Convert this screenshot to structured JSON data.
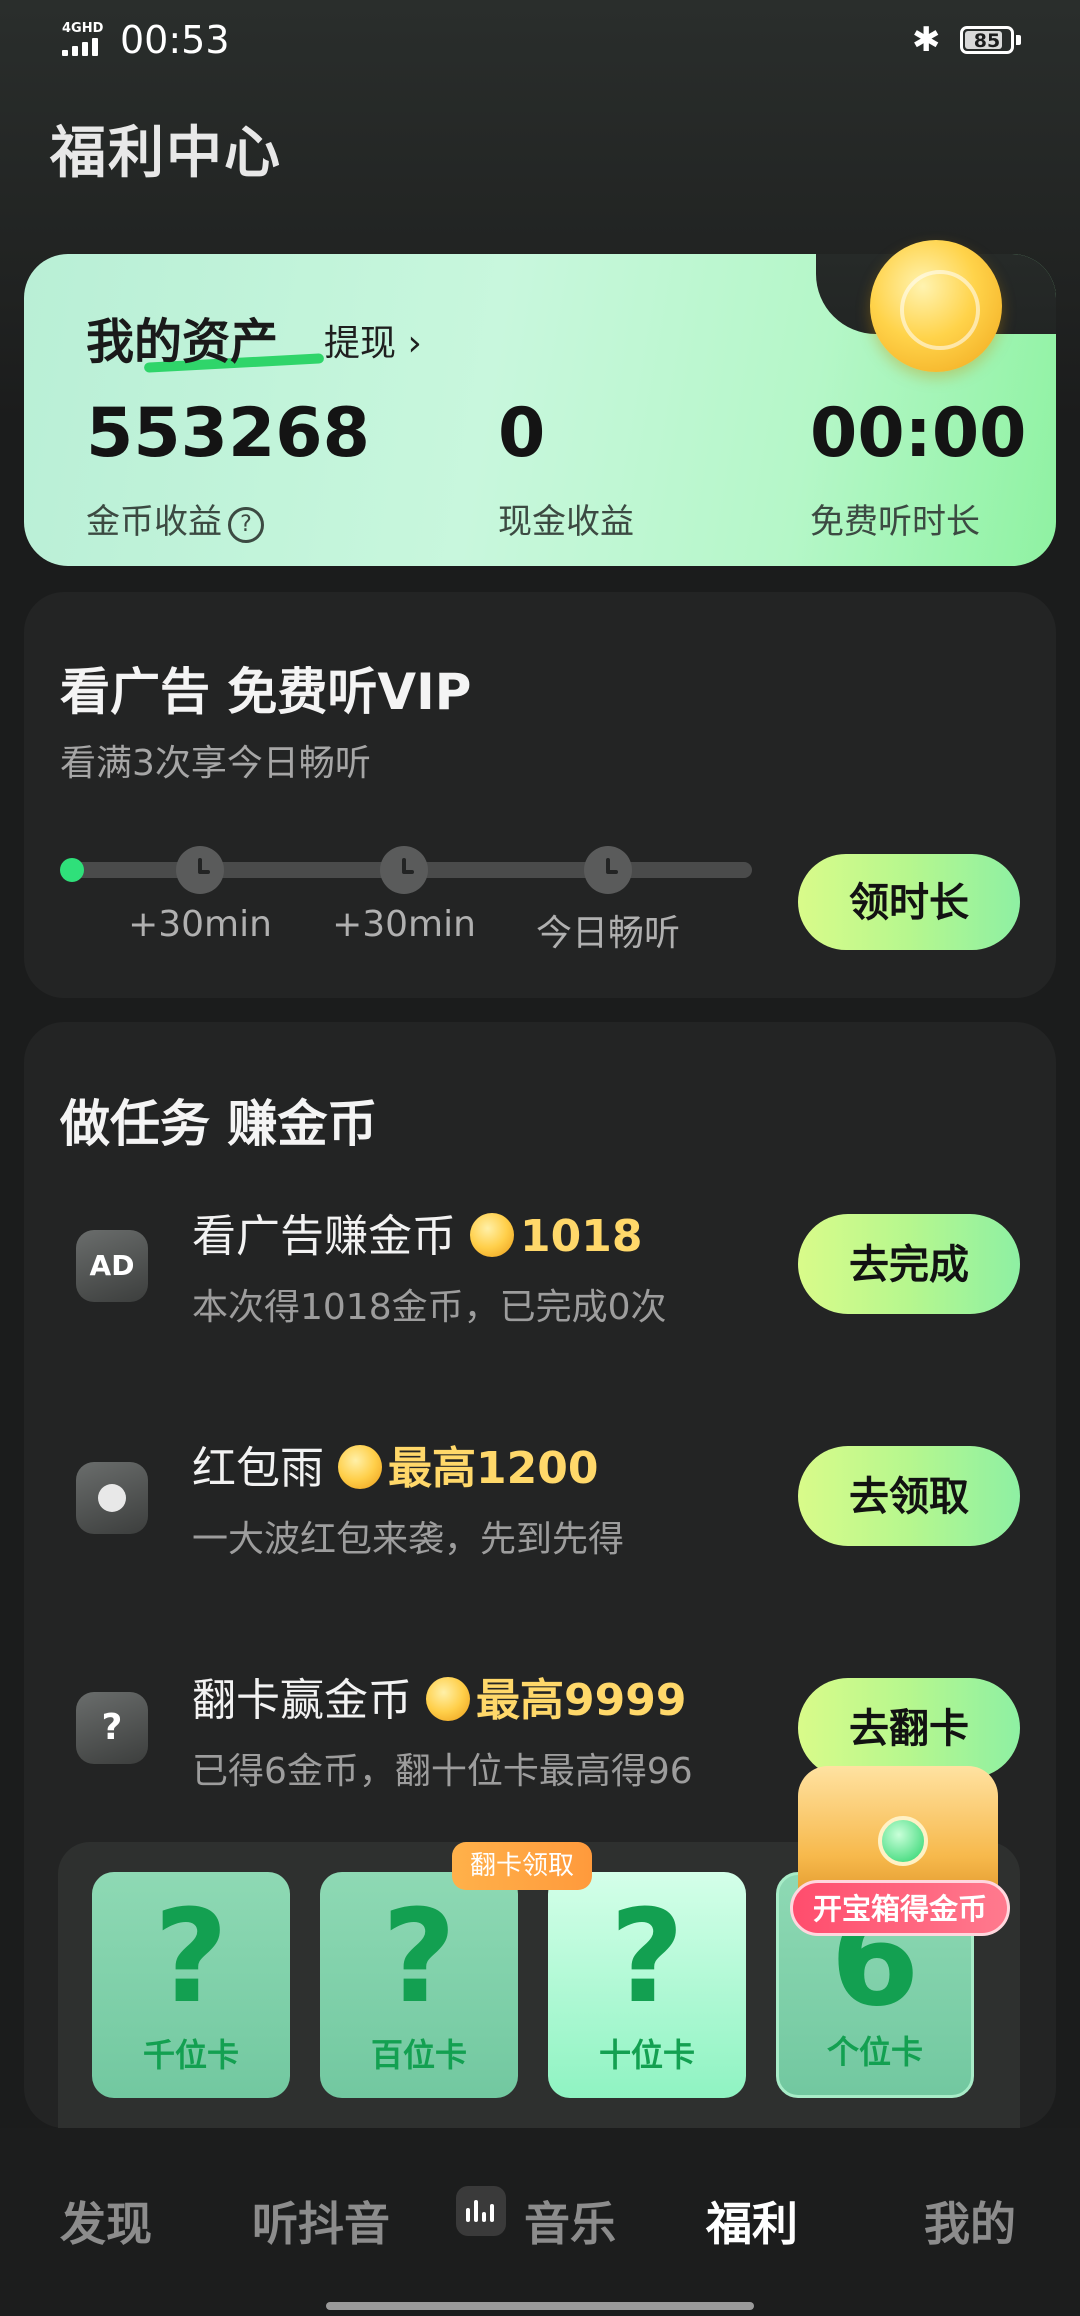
{
  "status_bar": {
    "network": "4GHD",
    "time": "00:53",
    "bluetooth": "bluetooth-icon",
    "battery": 85
  },
  "page_title": "福利中心",
  "assets": {
    "title": "我的资产",
    "withdraw_label": "提现 ›",
    "coins_value": "553268",
    "coins_label": "金币收益",
    "cash_value": "0",
    "cash_label": "现金收益",
    "listen_value": "00:00",
    "listen_label": "免费听时长"
  },
  "vip": {
    "title": "看广告 免费听VIP",
    "subtitle": "看满3次享今日畅听",
    "progress": 0,
    "nodes": [
      "+30min",
      "+30min",
      "今日畅听"
    ],
    "button": "领时长"
  },
  "tasks": {
    "title": "做任务 赚金币",
    "items": [
      {
        "icon": "ad-icon",
        "icon_text": "AD",
        "name": "看广告赚金币",
        "reward": "1018",
        "desc": "本次得1018金币，已完成0次",
        "button": "去完成"
      },
      {
        "icon": "red-packet-jar-icon",
        "icon_text": "",
        "name": "红包雨",
        "reward": "最高1200",
        "desc": "一大波红包来袭，先到先得",
        "button": "去领取"
      },
      {
        "icon": "flip-card-icon",
        "icon_text": "?",
        "name": "翻卡赢金币",
        "reward": "最高9999",
        "desc": "已得6金币，翻十位卡最高得96",
        "button": "去翻卡"
      }
    ]
  },
  "flip_cards": {
    "tip": "翻卡领取",
    "cards": [
      {
        "symbol": "?",
        "label": "千位卡"
      },
      {
        "symbol": "?",
        "label": "百位卡"
      },
      {
        "symbol": "?",
        "label": "十位卡"
      },
      {
        "symbol": "6",
        "label": "个位卡"
      }
    ]
  },
  "chest": {
    "label": "开宝箱得金币"
  },
  "bottom_nav": {
    "items": [
      "发现",
      "听抖音",
      "音乐",
      "福利",
      "我的"
    ],
    "active": "福利"
  },
  "colors": {
    "accent_green": "#2fe07a",
    "coin_gold": "#ffd86a",
    "background": "#1b1c1c"
  }
}
